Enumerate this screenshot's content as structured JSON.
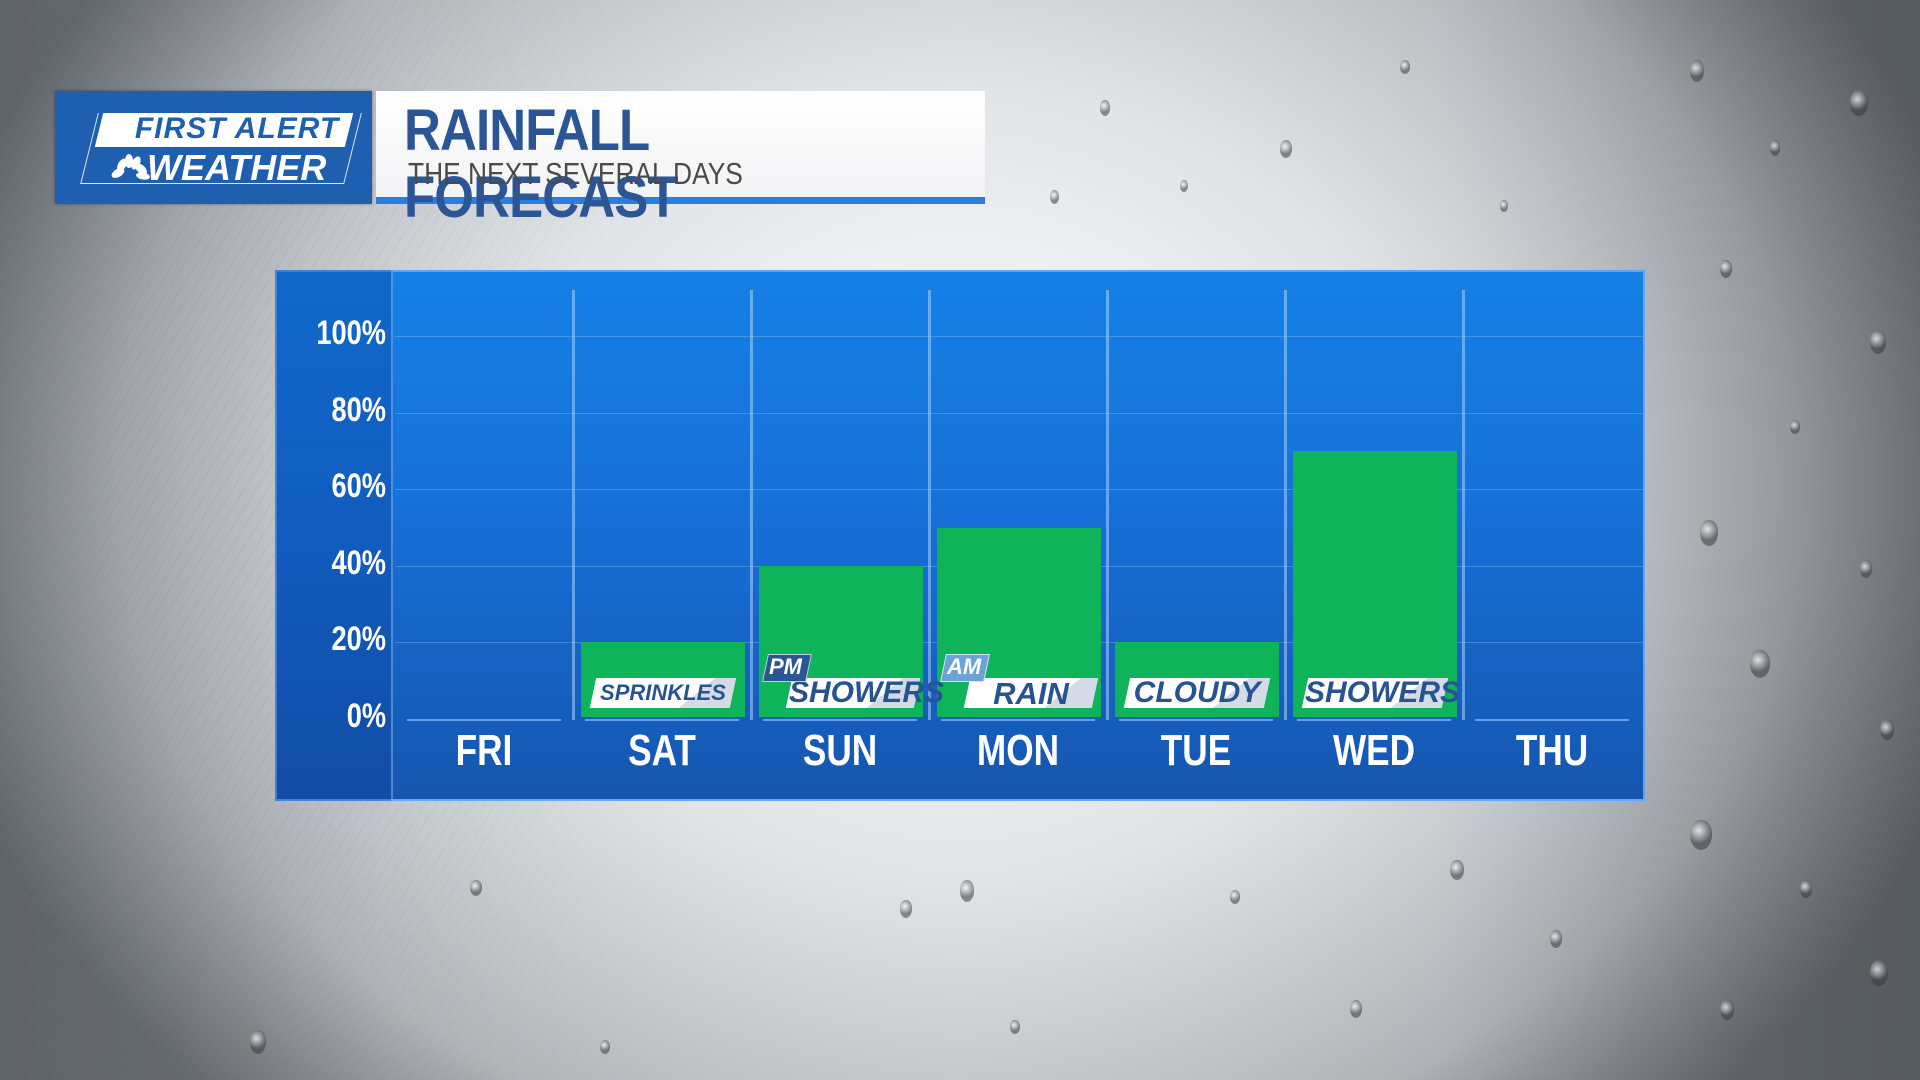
{
  "logo": {
    "line1": "FIRST ALERT",
    "line2": "WEATHER",
    "network_icon": "peacock-icon"
  },
  "header": {
    "title": "RAINFALL FORECAST",
    "subtitle": "THE NEXT SEVERAL DAYS"
  },
  "colors": {
    "bar": "#0fb45a",
    "chart_bg": "#1670d8",
    "title_text": "#2b5594",
    "label_text": "#275490",
    "pm_tag": "#2b5594",
    "am_tag": "#6ba3d6"
  },
  "chart_data": {
    "type": "bar",
    "title": "RAINFALL FORECAST",
    "subtitle": "THE NEXT SEVERAL DAYS",
    "xlabel": "",
    "ylabel": "",
    "categories": [
      "FRI",
      "SAT",
      "SUN",
      "MON",
      "TUE",
      "WED",
      "THU"
    ],
    "values": [
      0,
      20,
      40,
      50,
      20,
      70,
      0
    ],
    "ylim": [
      0,
      100
    ],
    "yticks": [
      "100%",
      "80%",
      "60%",
      "40%",
      "20%",
      "0%"
    ],
    "grid": true,
    "unit": "%",
    "annotations": [
      {
        "day": "SAT",
        "prefix": "",
        "text": "SPRINKLES"
      },
      {
        "day": "SUN",
        "prefix": "PM",
        "text": "SHOWERS"
      },
      {
        "day": "MON",
        "prefix": "AM",
        "text": "RAIN"
      },
      {
        "day": "TUE",
        "prefix": "",
        "text": "CLOUDY"
      },
      {
        "day": "WED",
        "prefix": "",
        "text": "SHOWERS"
      }
    ]
  }
}
